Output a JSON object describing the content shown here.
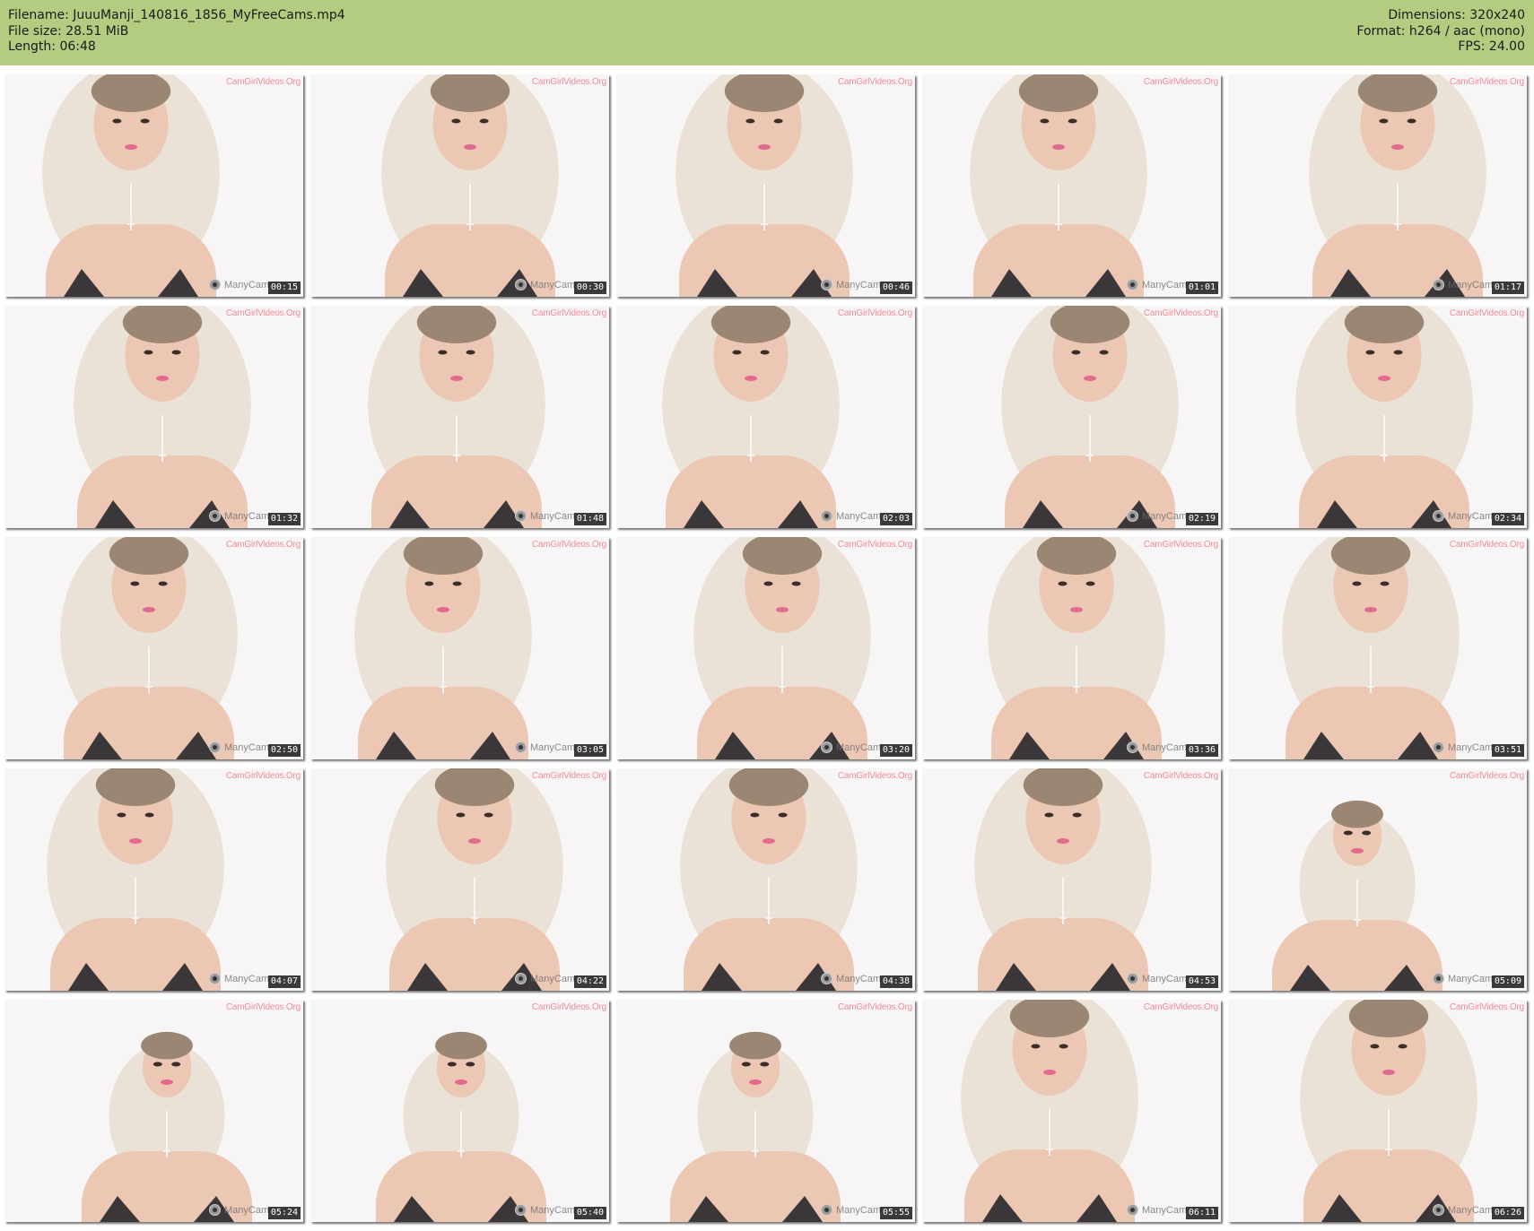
{
  "header": {
    "left": [
      "Filename: JuuuManji_140816_1856_MyFreeCams.mp4",
      "File size: 28.51 MiB",
      "Length: 06:48"
    ],
    "right": [
      "Dimensions: 320x240",
      "Format: h264 / aac (mono)",
      "FPS: 24.00"
    ]
  },
  "watermarks": {
    "site": "CamGirlVideos.Org",
    "cam": "ManyCam"
  },
  "colors": {
    "header_bg": "#b3cc80",
    "timestamp_bg": "#191919",
    "hair": "#eae2d6",
    "skin": "#ecc7b3",
    "top": "#1c1c22"
  },
  "thumbnails": [
    {
      "time": "00:15"
    },
    {
      "time": "00:30"
    },
    {
      "time": "00:46"
    },
    {
      "time": "01:01"
    },
    {
      "time": "01:17"
    },
    {
      "time": "01:32"
    },
    {
      "time": "01:48"
    },
    {
      "time": "02:03"
    },
    {
      "time": "02:19"
    },
    {
      "time": "02:34"
    },
    {
      "time": "02:50"
    },
    {
      "time": "03:05"
    },
    {
      "time": "03:20"
    },
    {
      "time": "03:36"
    },
    {
      "time": "03:51"
    },
    {
      "time": "04:07"
    },
    {
      "time": "04:22"
    },
    {
      "time": "04:38"
    },
    {
      "time": "04:53"
    },
    {
      "time": "05:09"
    },
    {
      "time": "05:24"
    },
    {
      "time": "05:40"
    },
    {
      "time": "05:55"
    },
    {
      "time": "06:11"
    },
    {
      "time": "06:26"
    }
  ]
}
